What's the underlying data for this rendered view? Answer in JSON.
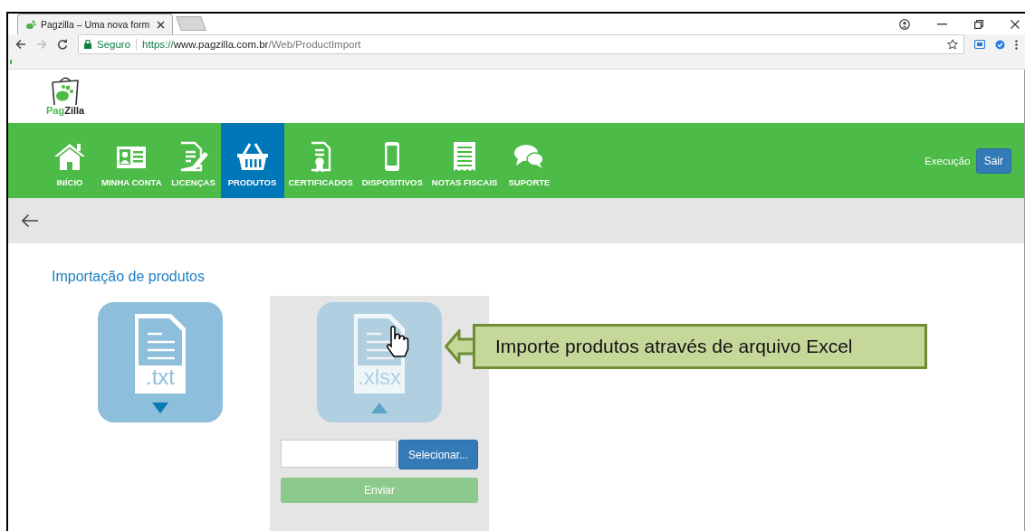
{
  "browser": {
    "tab_title": "Pagzilla – Uma nova form",
    "security_label": "Seguro",
    "url_scheme": "https://",
    "url_host": "www.pagzilla.com.br",
    "url_path": "/Web/ProductImport"
  },
  "logo": {
    "part_1": "Pag",
    "part_2": "Zilla"
  },
  "nav": {
    "items": [
      {
        "label": "INÍCIO",
        "kind": "house",
        "selected": false
      },
      {
        "label": "MINHA CONTA",
        "kind": "id-card",
        "selected": false
      },
      {
        "label": "LICENÇAS",
        "kind": "document-pen",
        "selected": false
      },
      {
        "label": "PRODUTOS",
        "kind": "basket",
        "selected": true
      },
      {
        "label": "CERTIFICADOS",
        "kind": "certificate",
        "selected": false
      },
      {
        "label": "DISPOSITIVOS",
        "kind": "phone",
        "selected": false
      },
      {
        "label": "NOTAS FISCAIS",
        "kind": "receipt",
        "selected": false
      },
      {
        "label": "SUPORTE",
        "kind": "chat",
        "selected": false
      }
    ],
    "user_label": "Execução",
    "logout_button": "Sair"
  },
  "page": {
    "title": "Importação de produtos",
    "options": [
      {
        "extension": ".txt",
        "selected": false
      },
      {
        "extension": ".xlsx",
        "selected": true
      }
    ],
    "select_button": "Selecionar...",
    "submit_button": "Enviar",
    "submit_disabled": true
  },
  "callout": {
    "text": "Importe produtos através de arquivo Excel"
  }
}
